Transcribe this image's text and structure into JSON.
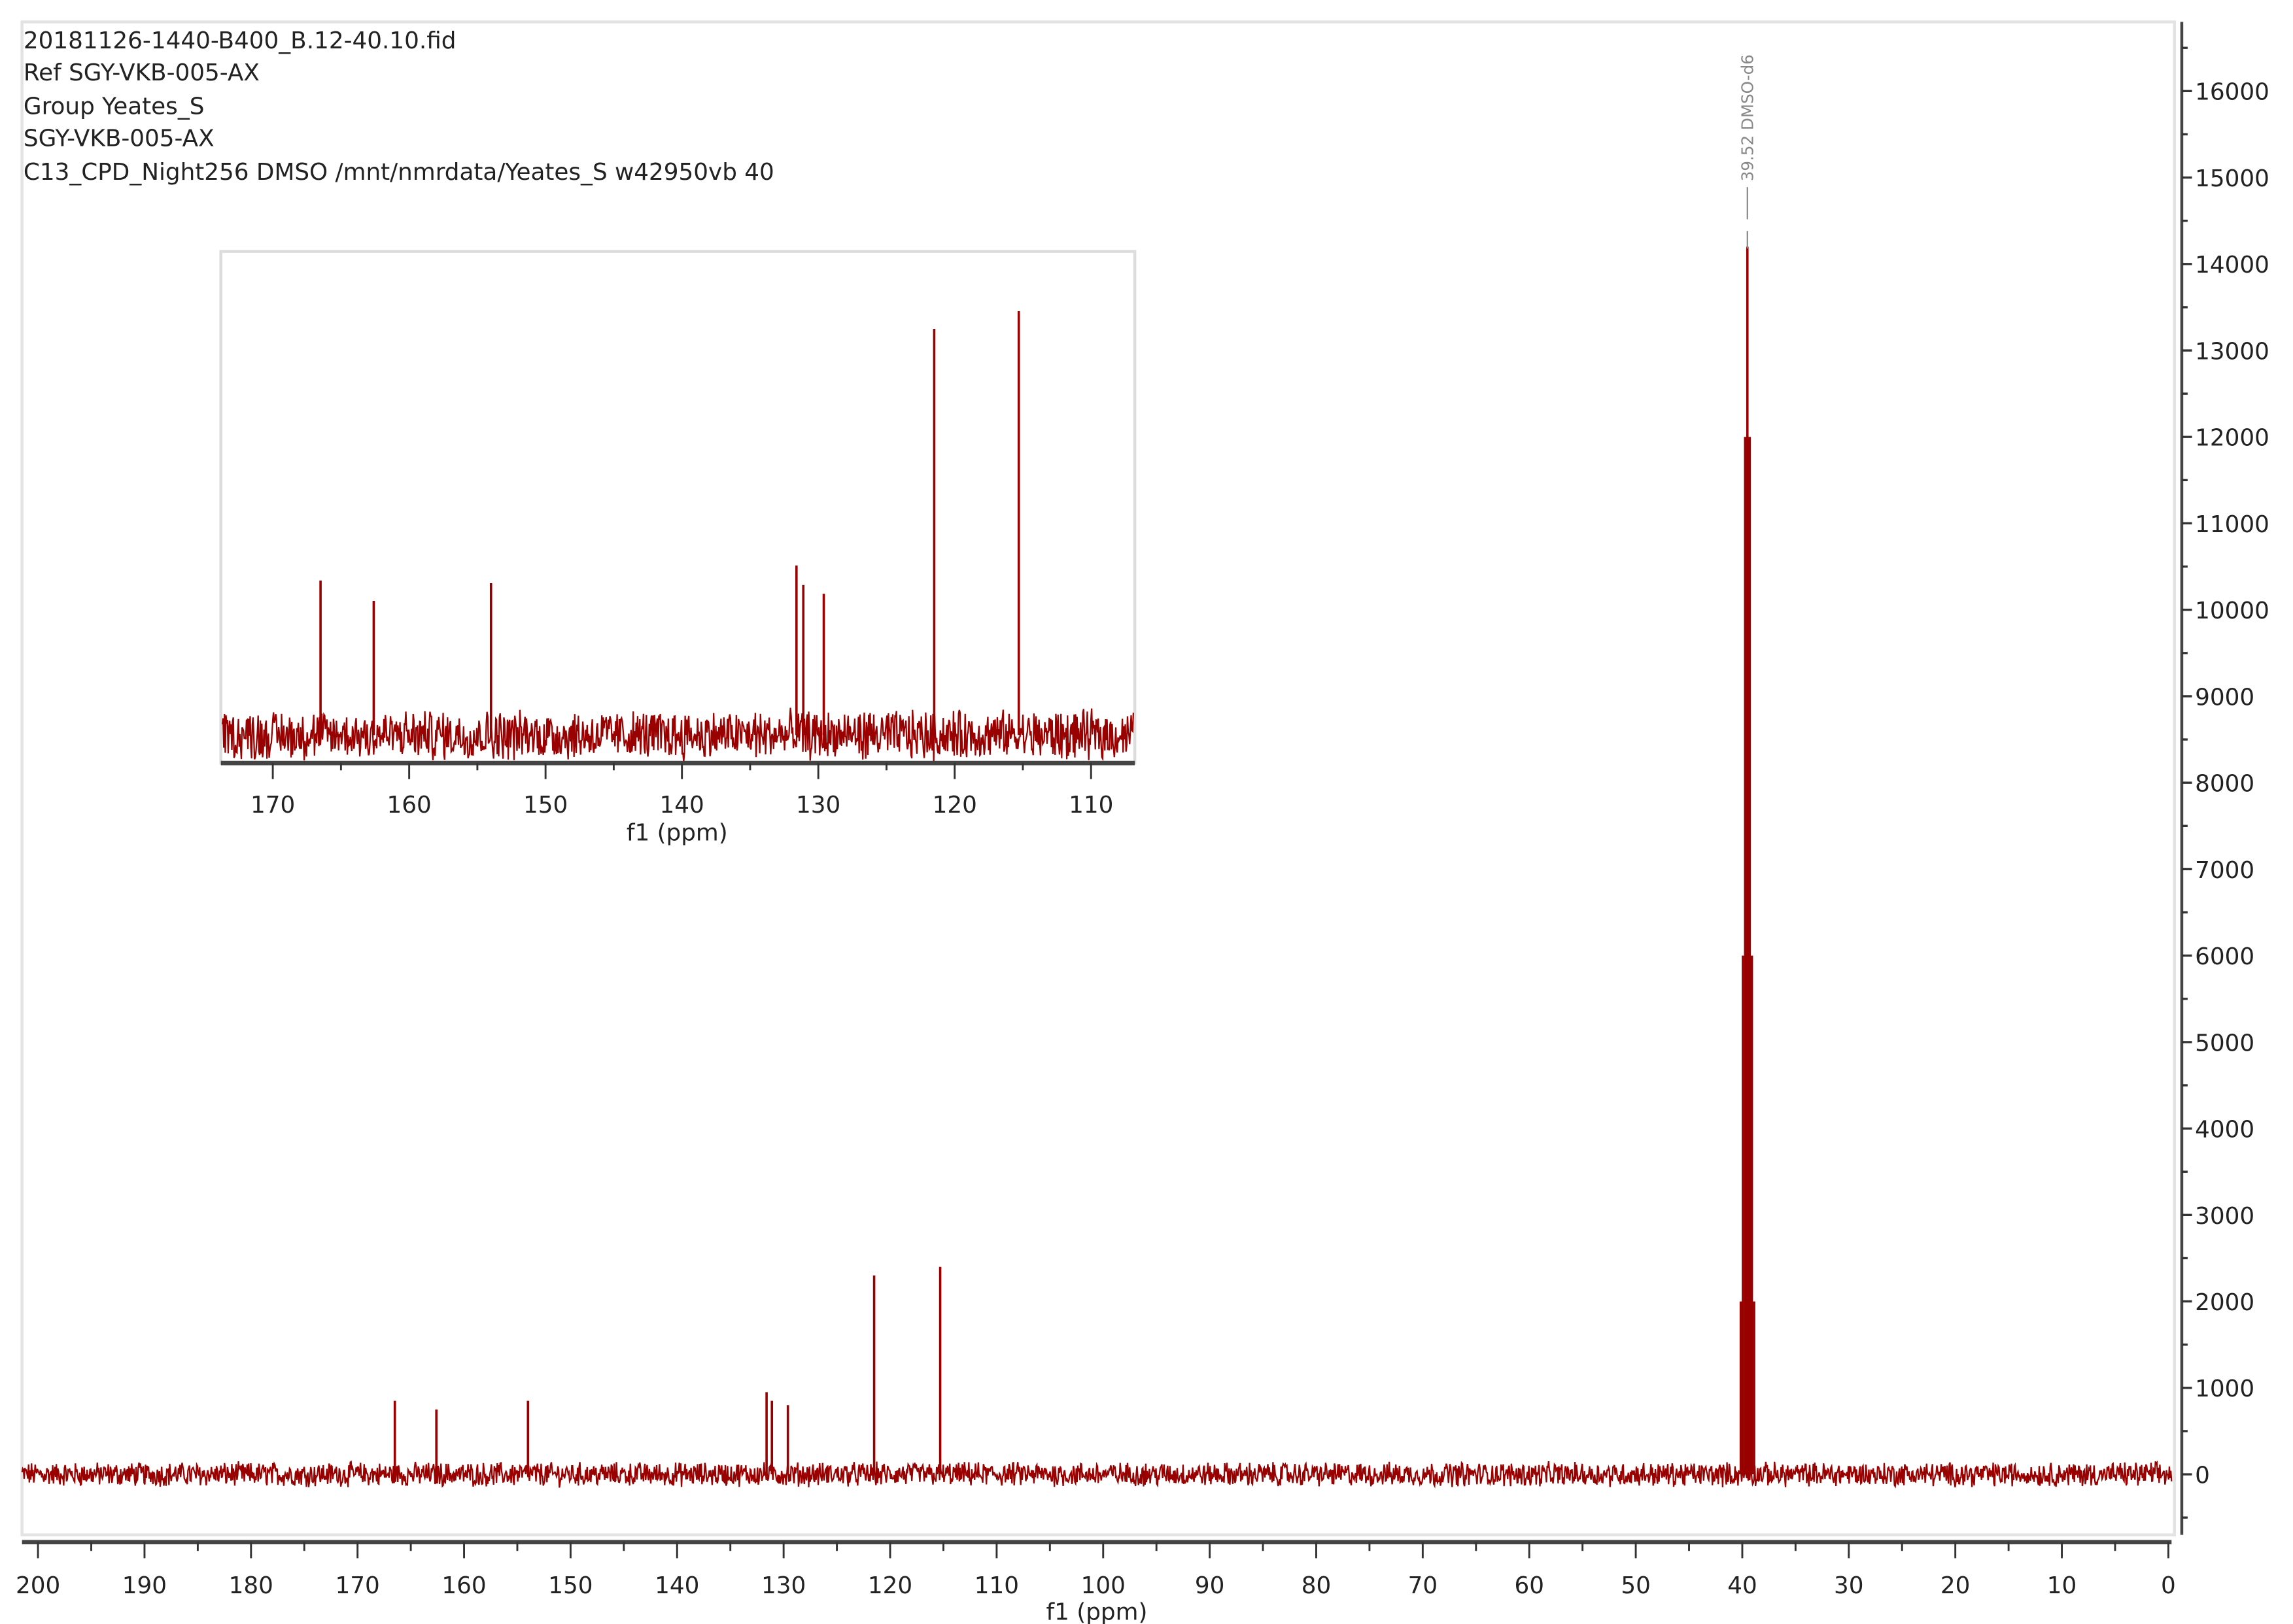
{
  "header": {
    "lines": [
      "20181126-1440-B400_B.12-40.10.fid",
      "Ref SGY-VKB-005-AX",
      "Group Yeates_S",
      "SGY-VKB-005-AX",
      "C13_CPD_Night256 DMSO /mnt/nmrdata/Yeates_S w42950vb 40"
    ]
  },
  "colors": {
    "spectrum": "#990000",
    "axis": "#333333",
    "frame": "#dddddd",
    "annotation": "#888888"
  },
  "chart_data": [
    {
      "type": "line",
      "title": "13C NMR spectrum",
      "xlabel": "f1 (ppm)",
      "ylabel": "",
      "xlim": [
        201.5,
        -0.3
      ],
      "ylim": [
        -700,
        16800
      ],
      "xticks": [
        200,
        190,
        180,
        170,
        160,
        150,
        140,
        130,
        120,
        110,
        100,
        90,
        80,
        70,
        60,
        50,
        40,
        30,
        20,
        10,
        0
      ],
      "yticks": [
        0,
        1000,
        2000,
        3000,
        4000,
        5000,
        6000,
        7000,
        8000,
        9000,
        10000,
        11000,
        12000,
        13000,
        14000,
        15000,
        16000
      ],
      "y_axis_side": "right",
      "noise_amplitude": 120,
      "peaks": [
        {
          "ppm": 166.5,
          "intensity": 850
        },
        {
          "ppm": 162.6,
          "intensity": 750
        },
        {
          "ppm": 154.0,
          "intensity": 850
        },
        {
          "ppm": 131.6,
          "intensity": 950
        },
        {
          "ppm": 131.1,
          "intensity": 850
        },
        {
          "ppm": 129.6,
          "intensity": 800
        },
        {
          "ppm": 121.5,
          "intensity": 2300
        },
        {
          "ppm": 115.3,
          "intensity": 2400
        },
        {
          "ppm": 40.14,
          "intensity": 2000
        },
        {
          "ppm": 39.94,
          "intensity": 6000
        },
        {
          "ppm": 39.73,
          "intensity": 12000
        },
        {
          "ppm": 39.52,
          "intensity": 14200
        },
        {
          "ppm": 39.31,
          "intensity": 12000
        },
        {
          "ppm": 39.1,
          "intensity": 6000
        },
        {
          "ppm": 38.89,
          "intensity": 2000
        }
      ],
      "annotations": [
        {
          "ppm": 39.52,
          "label": "39.52 DMSO-d6"
        }
      ]
    },
    {
      "type": "line",
      "title": "inset expansion",
      "xlabel": "f1 (ppm)",
      "xlim": [
        173.7,
        106.9
      ],
      "ylim": [
        -150,
        2730
      ],
      "xticks": [
        170,
        160,
        150,
        140,
        130,
        120,
        110
      ],
      "noise_amplitude": 120,
      "peaks": [
        {
          "ppm": 166.5,
          "intensity": 875
        },
        {
          "ppm": 162.6,
          "intensity": 760
        },
        {
          "ppm": 154.0,
          "intensity": 860
        },
        {
          "ppm": 131.6,
          "intensity": 960
        },
        {
          "ppm": 131.1,
          "intensity": 850
        },
        {
          "ppm": 129.6,
          "intensity": 800
        },
        {
          "ppm": 121.5,
          "intensity": 2300
        },
        {
          "ppm": 115.3,
          "intensity": 2400
        }
      ]
    }
  ]
}
